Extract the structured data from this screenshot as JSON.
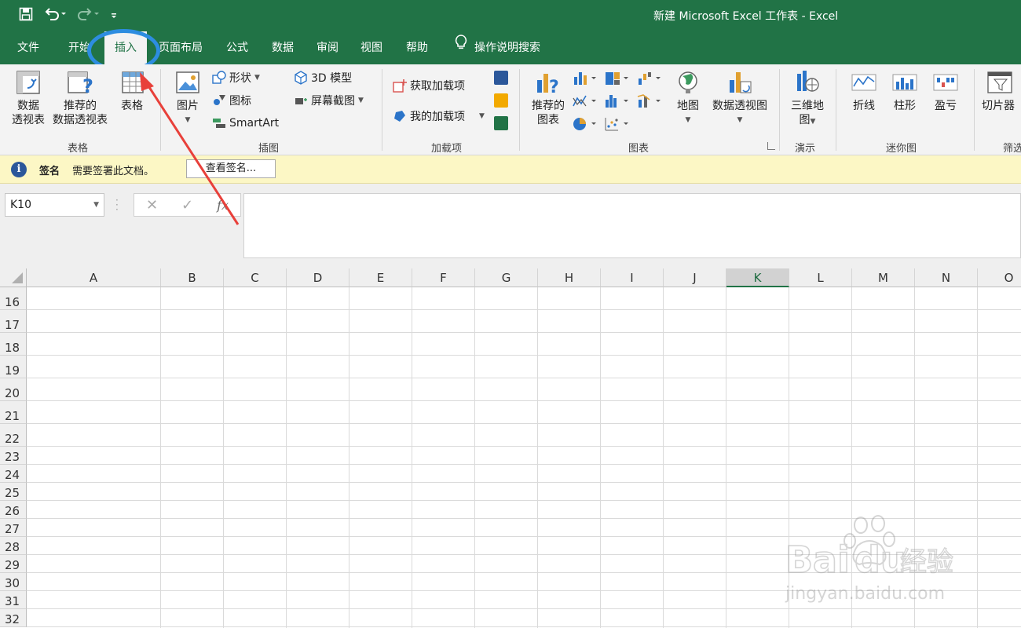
{
  "window": {
    "title": "新建 Microsoft Excel 工作表  -  Excel"
  },
  "ribbon_tabs": [
    {
      "label": "文件",
      "active": false
    },
    {
      "label": "开始",
      "active": false
    },
    {
      "label": "插入",
      "active": true
    },
    {
      "label": "页面布局",
      "active": false
    },
    {
      "label": "公式",
      "active": false
    },
    {
      "label": "数据",
      "active": false
    },
    {
      "label": "审阅",
      "active": false
    },
    {
      "label": "视图",
      "active": false
    },
    {
      "label": "帮助",
      "active": false
    }
  ],
  "tell_me": {
    "label": "操作说明搜索"
  },
  "groups": {
    "tables": {
      "label": "表格",
      "pivot_table": "数据\n透视表",
      "recommended_pivot": "推荐的\n数据透视表",
      "table": "表格"
    },
    "illustrations": {
      "label": "插图",
      "pictures": "图片",
      "shapes": "形状",
      "icons": "图标",
      "smartart": "SmartArt",
      "model_3d": "3D 模型",
      "screenshot": "屏幕截图"
    },
    "addins": {
      "label": "加载项",
      "get_addins": "获取加载项",
      "my_addins": "我的加载项"
    },
    "charts": {
      "label": "图表",
      "recommended_charts": "推荐的\n图表",
      "maps": "地图",
      "pivot_chart": "数据透视图"
    },
    "tours": {
      "label": "演示",
      "map_3d": "三维地\n图"
    },
    "sparklines": {
      "label": "迷你图",
      "line": "折线",
      "column": "柱形",
      "win_loss": "盈亏"
    },
    "filters": {
      "label": "筛选",
      "slicer": "切片器"
    }
  },
  "message_bar": {
    "title": "签名",
    "text": "需要签署此文档。",
    "button": "查看签名..."
  },
  "formula_bar": {
    "name_box": "K10",
    "formula": ""
  },
  "grid": {
    "columns": [
      "A",
      "B",
      "C",
      "D",
      "E",
      "F",
      "G",
      "H",
      "I",
      "J",
      "K",
      "L",
      "M",
      "N",
      "O"
    ],
    "selected_column": "K",
    "rows": [
      "16",
      "17",
      "18",
      "19",
      "20",
      "21",
      "22",
      "23",
      "24",
      "25",
      "26",
      "27",
      "28",
      "29",
      "30",
      "31",
      "32"
    ]
  },
  "watermark": {
    "text": "Bai经验",
    "subtext": "jingyan.baidu.com"
  },
  "colors": {
    "excel_green": "#217346",
    "highlight_blue": "#2d8de0",
    "arrow_red": "#e8403a"
  }
}
